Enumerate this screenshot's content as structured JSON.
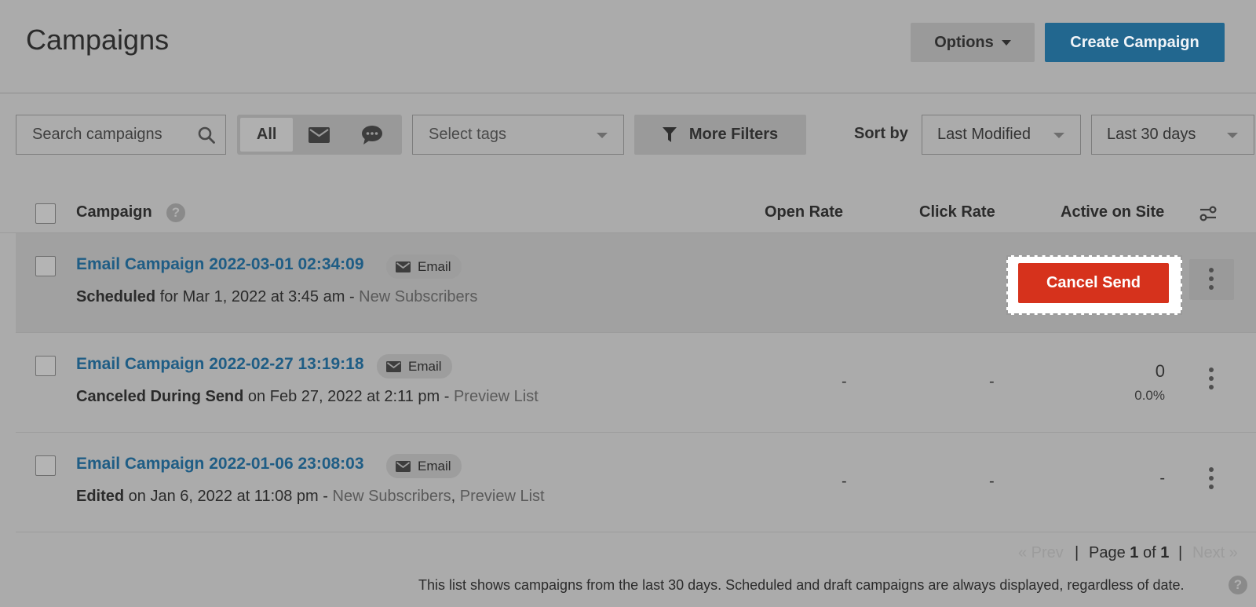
{
  "header": {
    "title": "Campaigns",
    "options_label": "Options",
    "create_label": "Create Campaign"
  },
  "toolbar": {
    "search_placeholder": "Search campaigns",
    "channel_all": "All",
    "tags_placeholder": "Select tags",
    "more_filters": "More Filters",
    "sort_label": "Sort by",
    "sort_value": "Last Modified",
    "range_value": "Last 30 days"
  },
  "table": {
    "columns": {
      "campaign": "Campaign",
      "open_rate": "Open Rate",
      "click_rate": "Click Rate",
      "active_on_site": "Active on Site"
    },
    "rows": [
      {
        "name": "Email Campaign 2022-03-01 02:34:09",
        "channel": "Email",
        "status": "Scheduled",
        "status_suffix": " for ",
        "date": "Mar 1, 2022 at 3:45 am",
        "sep": " - ",
        "lists": [
          "New Subscribers"
        ],
        "action": "Cancel Send"
      },
      {
        "name": "Email Campaign 2022-02-27 13:19:18",
        "channel": "Email",
        "status": "Canceled During Send",
        "status_suffix": " on ",
        "date": "Feb 27, 2022 at 2:11 pm",
        "sep": " - ",
        "lists": [
          "Preview List"
        ],
        "open_rate": "-",
        "click_rate": "-",
        "active_count": "0",
        "active_pct": "0.0%"
      },
      {
        "name": "Email Campaign 2022-01-06 23:08:03",
        "channel": "Email",
        "status": "Edited",
        "status_suffix": " on ",
        "date": "Jan 6, 2022 at 11:08 pm",
        "sep": " - ",
        "lists": [
          "New Subscribers",
          "Preview List"
        ],
        "list_sep": ", ",
        "open_rate": "-",
        "click_rate": "-",
        "active_count": "-"
      }
    ]
  },
  "pagination": {
    "prev": "« Prev",
    "divider": "|",
    "page_word": "Page ",
    "current": "1",
    "of_word": " of ",
    "total": "1",
    "next": "Next »"
  },
  "footnote": "This list shows campaigns from the last 30 days. Scheduled and draft campaigns are always displayed, regardless of date.",
  "icons": {
    "search": "search-icon",
    "email": "envelope-icon",
    "sms": "chat-bubble-icon",
    "filter": "funnel-icon",
    "columns": "column-settings-icon",
    "help": "help-icon",
    "menu": "kebab-menu-icon"
  },
  "colors": {
    "primary": "#22678f",
    "danger": "#d6321c",
    "link": "#1f5d85"
  }
}
